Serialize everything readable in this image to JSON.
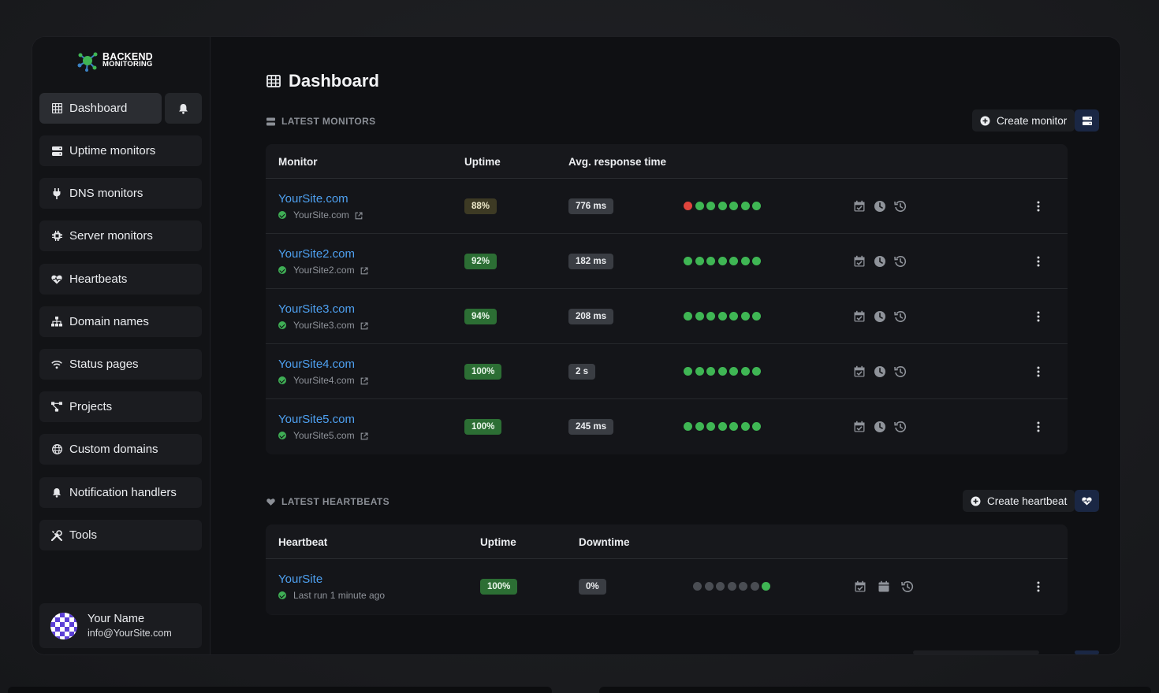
{
  "logo": {
    "line1": "BACKEND",
    "line2": "MONITORING"
  },
  "sidebar": {
    "items": [
      {
        "label": "Dashboard",
        "icon": "grid-icon",
        "active": true
      },
      {
        "label": "Uptime monitors",
        "icon": "server-icon"
      },
      {
        "label": "DNS monitors",
        "icon": "plug-icon"
      },
      {
        "label": "Server monitors",
        "icon": "chip-icon"
      },
      {
        "label": "Heartbeats",
        "icon": "heart-pulse-icon"
      },
      {
        "label": "Domain names",
        "icon": "network-icon"
      },
      {
        "label": "Status pages",
        "icon": "wifi-icon"
      },
      {
        "label": "Projects",
        "icon": "diagram-icon"
      },
      {
        "label": "Custom domains",
        "icon": "globe-icon"
      },
      {
        "label": "Notification handlers",
        "icon": "bell-icon"
      },
      {
        "label": "Tools",
        "icon": "tools-icon"
      }
    ]
  },
  "user": {
    "name": "Your Name",
    "email": "info@YourSite.com"
  },
  "page": {
    "title": "Dashboard"
  },
  "monitors": {
    "section_label": "LATEST MONITORS",
    "create_label": "Create monitor",
    "headers": {
      "monitor": "Monitor",
      "uptime": "Uptime",
      "response": "Avg. response time"
    },
    "rows": [
      {
        "name": "YourSite.com",
        "host": "YourSite.com",
        "uptime": "88%",
        "uptime_level": "warn",
        "response": "776 ms",
        "history": [
          "down",
          "up",
          "up",
          "up",
          "up",
          "up",
          "up"
        ]
      },
      {
        "name": "YourSite2.com",
        "host": "YourSite2.com",
        "uptime": "92%",
        "uptime_level": "good",
        "response": "182 ms",
        "history": [
          "up",
          "up",
          "up",
          "up",
          "up",
          "up",
          "up"
        ]
      },
      {
        "name": "YourSite3.com",
        "host": "YourSite3.com",
        "uptime": "94%",
        "uptime_level": "good",
        "response": "208 ms",
        "history": [
          "up",
          "up",
          "up",
          "up",
          "up",
          "up",
          "up"
        ]
      },
      {
        "name": "YourSite4.com",
        "host": "YourSite4.com",
        "uptime": "100%",
        "uptime_level": "good",
        "response": "2 s",
        "history": [
          "up",
          "up",
          "up",
          "up",
          "up",
          "up",
          "up"
        ]
      },
      {
        "name": "YourSite5.com",
        "host": "YourSite5.com",
        "uptime": "100%",
        "uptime_level": "good",
        "response": "245 ms",
        "history": [
          "up",
          "up",
          "up",
          "up",
          "up",
          "up",
          "up"
        ]
      }
    ]
  },
  "heartbeats": {
    "section_label": "LATEST HEARTBEATS",
    "create_label": "Create heartbeat",
    "headers": {
      "heartbeat": "Heartbeat",
      "uptime": "Uptime",
      "downtime": "Downtime"
    },
    "rows": [
      {
        "name": "YourSite",
        "sub": "Last run 1 minute ago",
        "uptime": "100%",
        "downtime": "0%",
        "history": [
          "none",
          "none",
          "none",
          "none",
          "none",
          "none",
          "up"
        ]
      }
    ]
  },
  "colors": {
    "accent_link": "#4ea0f0",
    "success": "#3fb654",
    "danger": "#e0453d",
    "square_button": "#1a2744"
  }
}
